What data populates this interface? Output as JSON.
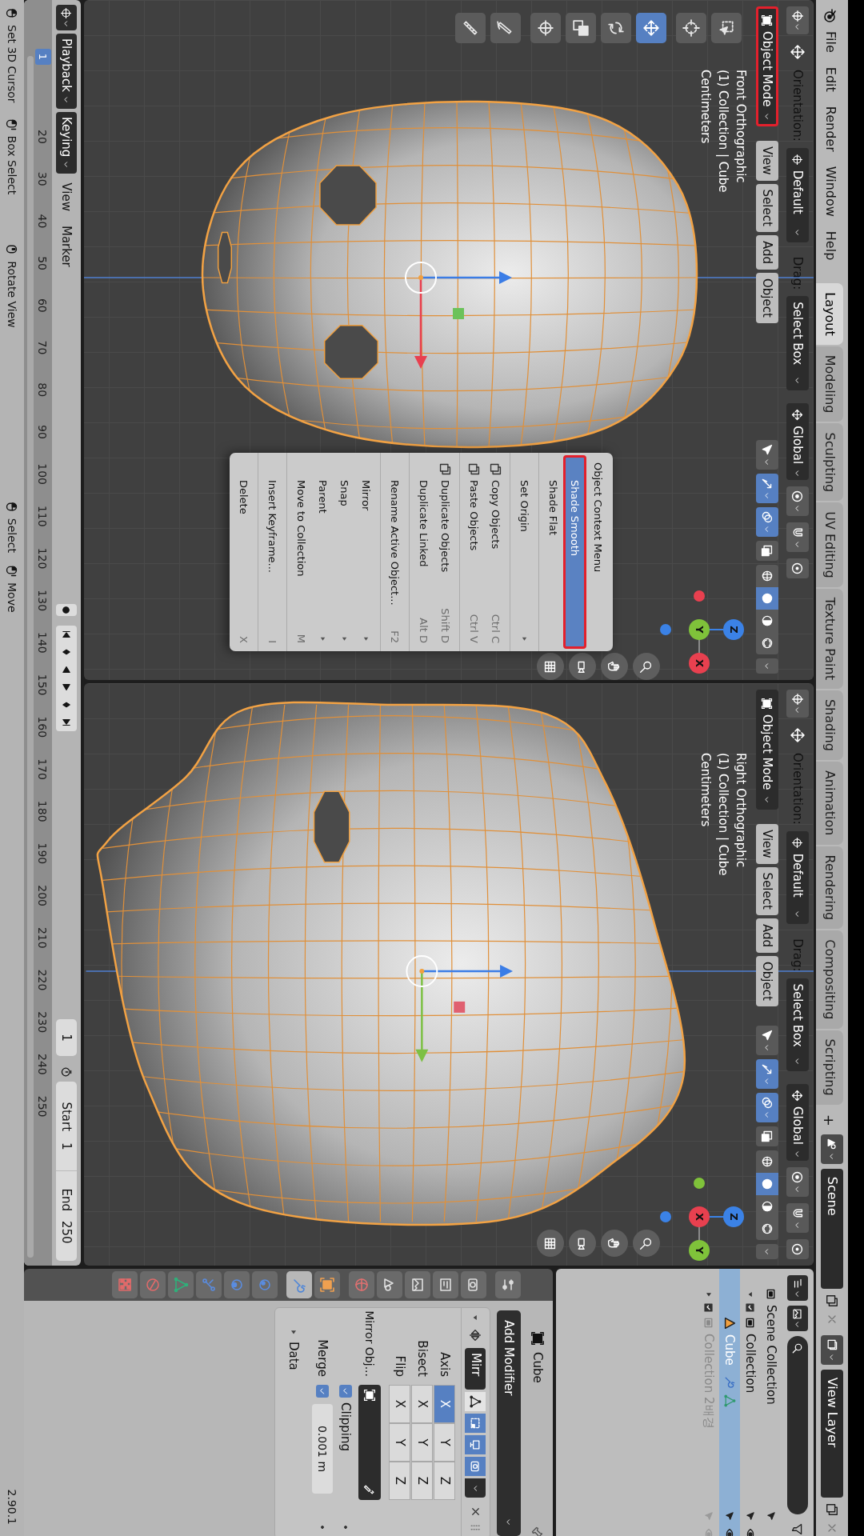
{
  "top_bar": {
    "menus": [
      "File",
      "Edit",
      "Render",
      "Window",
      "Help"
    ],
    "workspaces": [
      {
        "label": "Layout",
        "selected": true
      },
      {
        "label": "Modeling",
        "selected": false
      },
      {
        "label": "Sculpting",
        "selected": false
      },
      {
        "label": "UV Editing",
        "selected": false
      },
      {
        "label": "Texture Paint",
        "selected": false
      },
      {
        "label": "Shading",
        "selected": false
      },
      {
        "label": "Animation",
        "selected": false
      },
      {
        "label": "Rendering",
        "selected": false
      },
      {
        "label": "Compositing",
        "selected": false
      },
      {
        "label": "Scripting",
        "selected": false
      }
    ],
    "add_workspace": "+",
    "scene": "Scene",
    "view_layer": "View Layer"
  },
  "viewports": [
    {
      "kind": "front",
      "orientation_label": "Orientation:",
      "orientation": "Default",
      "drag_label": "Drag:",
      "drag": "Select Box",
      "transform": "Global",
      "mode": "Object Mode",
      "mode_outlined": true,
      "menus": [
        "View",
        "Select",
        "Add",
        "Object"
      ],
      "toggles": [
        {
          "on": false
        },
        {
          "on": true
        },
        {
          "on": true
        }
      ],
      "shading": [
        {
          "selected": false
        },
        {
          "selected": true
        },
        {
          "selected": false
        },
        {
          "selected": false
        }
      ],
      "view_name": "Front Orthographic",
      "collection": "(1) Collection | Cube",
      "units": "Centimeters",
      "axes": [
        "Z",
        "Y",
        "X"
      ],
      "toolbar": [
        {
          "selected": false
        },
        {
          "selected": false
        },
        {
          "selected": true
        },
        {
          "selected": false
        },
        {
          "selected": false
        },
        {
          "selected": false
        },
        {
          "selected": false
        },
        {
          "selected": false
        }
      ]
    },
    {
      "kind": "side",
      "orientation_label": "Orientation:",
      "orientation": "Default",
      "drag_label": "Drag:",
      "drag": "Select Box",
      "transform": "Global",
      "mode": "Object Mode",
      "mode_outlined": false,
      "menus": [
        "View",
        "Select",
        "Add",
        "Object"
      ],
      "toggles": [
        {
          "on": false
        },
        {
          "on": true
        },
        {
          "on": true
        }
      ],
      "shading": [
        {
          "selected": false
        },
        {
          "selected": true
        },
        {
          "selected": false
        },
        {
          "selected": false
        }
      ],
      "view_name": "Right Orthographic",
      "collection": "(1) Collection | Cube",
      "units": "Centimeters",
      "axes": [
        "Z",
        "X",
        "Y"
      ]
    }
  ],
  "context_menu": {
    "title": "Object Context Menu",
    "items": [
      {
        "kind": "item",
        "label": "Shade Smooth",
        "selected": true,
        "outlined": true
      },
      {
        "kind": "item",
        "label": "Shade Flat",
        "selected": false
      },
      {
        "kind": "separator"
      },
      {
        "kind": "item",
        "label": "Set Origin",
        "selected": false,
        "submenu": true
      },
      {
        "kind": "separator"
      },
      {
        "kind": "item",
        "label": "Copy Objects",
        "shortcut": "Ctrl C",
        "selected": false
      },
      {
        "kind": "item",
        "label": "Paste Objects",
        "shortcut": "Ctrl V",
        "selected": false
      },
      {
        "kind": "separator"
      },
      {
        "kind": "item",
        "label": "Duplicate Objects",
        "shortcut": "Shift D",
        "selected": false
      },
      {
        "kind": "item",
        "label": "Duplicate Linked",
        "shortcut": "Alt D",
        "selected": false
      },
      {
        "kind": "separator"
      },
      {
        "kind": "item",
        "label": "Rename Active Object...",
        "shortcut": "F2",
        "selected": false
      },
      {
        "kind": "separator"
      },
      {
        "kind": "item",
        "label": "Mirror",
        "selected": false,
        "submenu": true
      },
      {
        "kind": "item",
        "label": "Snap",
        "selected": false,
        "submenu": true
      },
      {
        "kind": "item",
        "label": "Parent",
        "selected": false,
        "submenu": true
      },
      {
        "kind": "item",
        "label": "Move to Collection",
        "shortcut": "M",
        "selected": false
      },
      {
        "kind": "separator"
      },
      {
        "kind": "item",
        "label": "Insert Keyframe...",
        "shortcut": "I",
        "selected": false
      },
      {
        "kind": "separator"
      },
      {
        "kind": "item",
        "label": "Delete",
        "shortcut": "X",
        "selected": false
      }
    ]
  },
  "timeline": {
    "menus": [
      {
        "kind": "dropdown",
        "label": "Playback"
      },
      {
        "kind": "dropdown",
        "label": "Keying"
      },
      {
        "kind": "menu",
        "label": "View"
      },
      {
        "kind": "menu",
        "label": "Marker"
      }
    ],
    "current_frame": "1",
    "start_label": "Start",
    "start": "1",
    "end_label": "End",
    "end": "250",
    "playhead": "1",
    "ruler": [
      "20",
      "30",
      "40",
      "50",
      "60",
      "70",
      "80",
      "90",
      "100",
      "110",
      "120",
      "130",
      "140",
      "150",
      "160",
      "170",
      "180",
      "190",
      "200",
      "210",
      "220",
      "230",
      "240",
      "250"
    ]
  },
  "outliner": {
    "tree": [
      {
        "kind": "collection",
        "label": "Scene Collection",
        "selected": false,
        "children": [
          {
            "kind": "collection",
            "label": "Collection",
            "selected": false,
            "expanded": true,
            "children": [
              {
                "kind": "object",
                "label": "Cube",
                "selected": true
              }
            ]
          },
          {
            "kind": "collection",
            "label": "Collection 2배경",
            "selected": false,
            "expanded": false,
            "disabled": true
          }
        ]
      }
    ]
  },
  "properties": {
    "tabs": [
      {
        "selected": false
      },
      {
        "selected": false
      },
      {
        "selected": false
      },
      {
        "selected": false
      },
      {
        "selected": false
      },
      {
        "selected": false
      },
      {
        "selected": false
      },
      {
        "selected": true
      },
      {
        "selected": false
      },
      {
        "selected": false
      },
      {
        "selected": false
      },
      {
        "selected": false
      },
      {
        "selected": false
      },
      {
        "selected": false
      }
    ],
    "object": "Cube",
    "add_modifier": "Add Modifier",
    "modifier": {
      "expanded": true,
      "name": "Mirr",
      "display_toggles": [
        {
          "on": false
        },
        {
          "on": true
        },
        {
          "on": true
        },
        {
          "on": true
        }
      ],
      "rows": [
        {
          "label": "Axis",
          "toggles": [
            {
              "label": "X",
              "on": true
            },
            {
              "label": "Y",
              "on": false
            },
            {
              "label": "Z",
              "on": false
            }
          ]
        },
        {
          "label": "Bisect",
          "toggles": [
            {
              "label": "X",
              "on": false
            },
            {
              "label": "Y",
              "on": false
            },
            {
              "label": "Z",
              "on": false
            }
          ]
        },
        {
          "label": "Flip",
          "toggles": [
            {
              "label": "X",
              "on": false
            },
            {
              "label": "Y",
              "on": false
            },
            {
              "label": "Z",
              "on": false
            }
          ]
        }
      ],
      "mirror_object_label": "Mirror Obj...",
      "clipping": {
        "label": "Clipping",
        "checked": true
      },
      "merge": {
        "label": "Merge",
        "checked": true,
        "value": "0.001 m"
      },
      "data": {
        "label": "Data",
        "expanded": false
      }
    }
  },
  "status_bar": {
    "hints": [
      {
        "label": "Set 3D Cursor",
        "kind": "left"
      },
      {
        "label": "Box Select",
        "kind": "drag"
      },
      {
        "label": "Rotate View",
        "kind": "middle"
      },
      {
        "label": "Select",
        "kind": "left"
      },
      {
        "label": "Move",
        "kind": "drag"
      }
    ],
    "version": "2.90.1"
  }
}
